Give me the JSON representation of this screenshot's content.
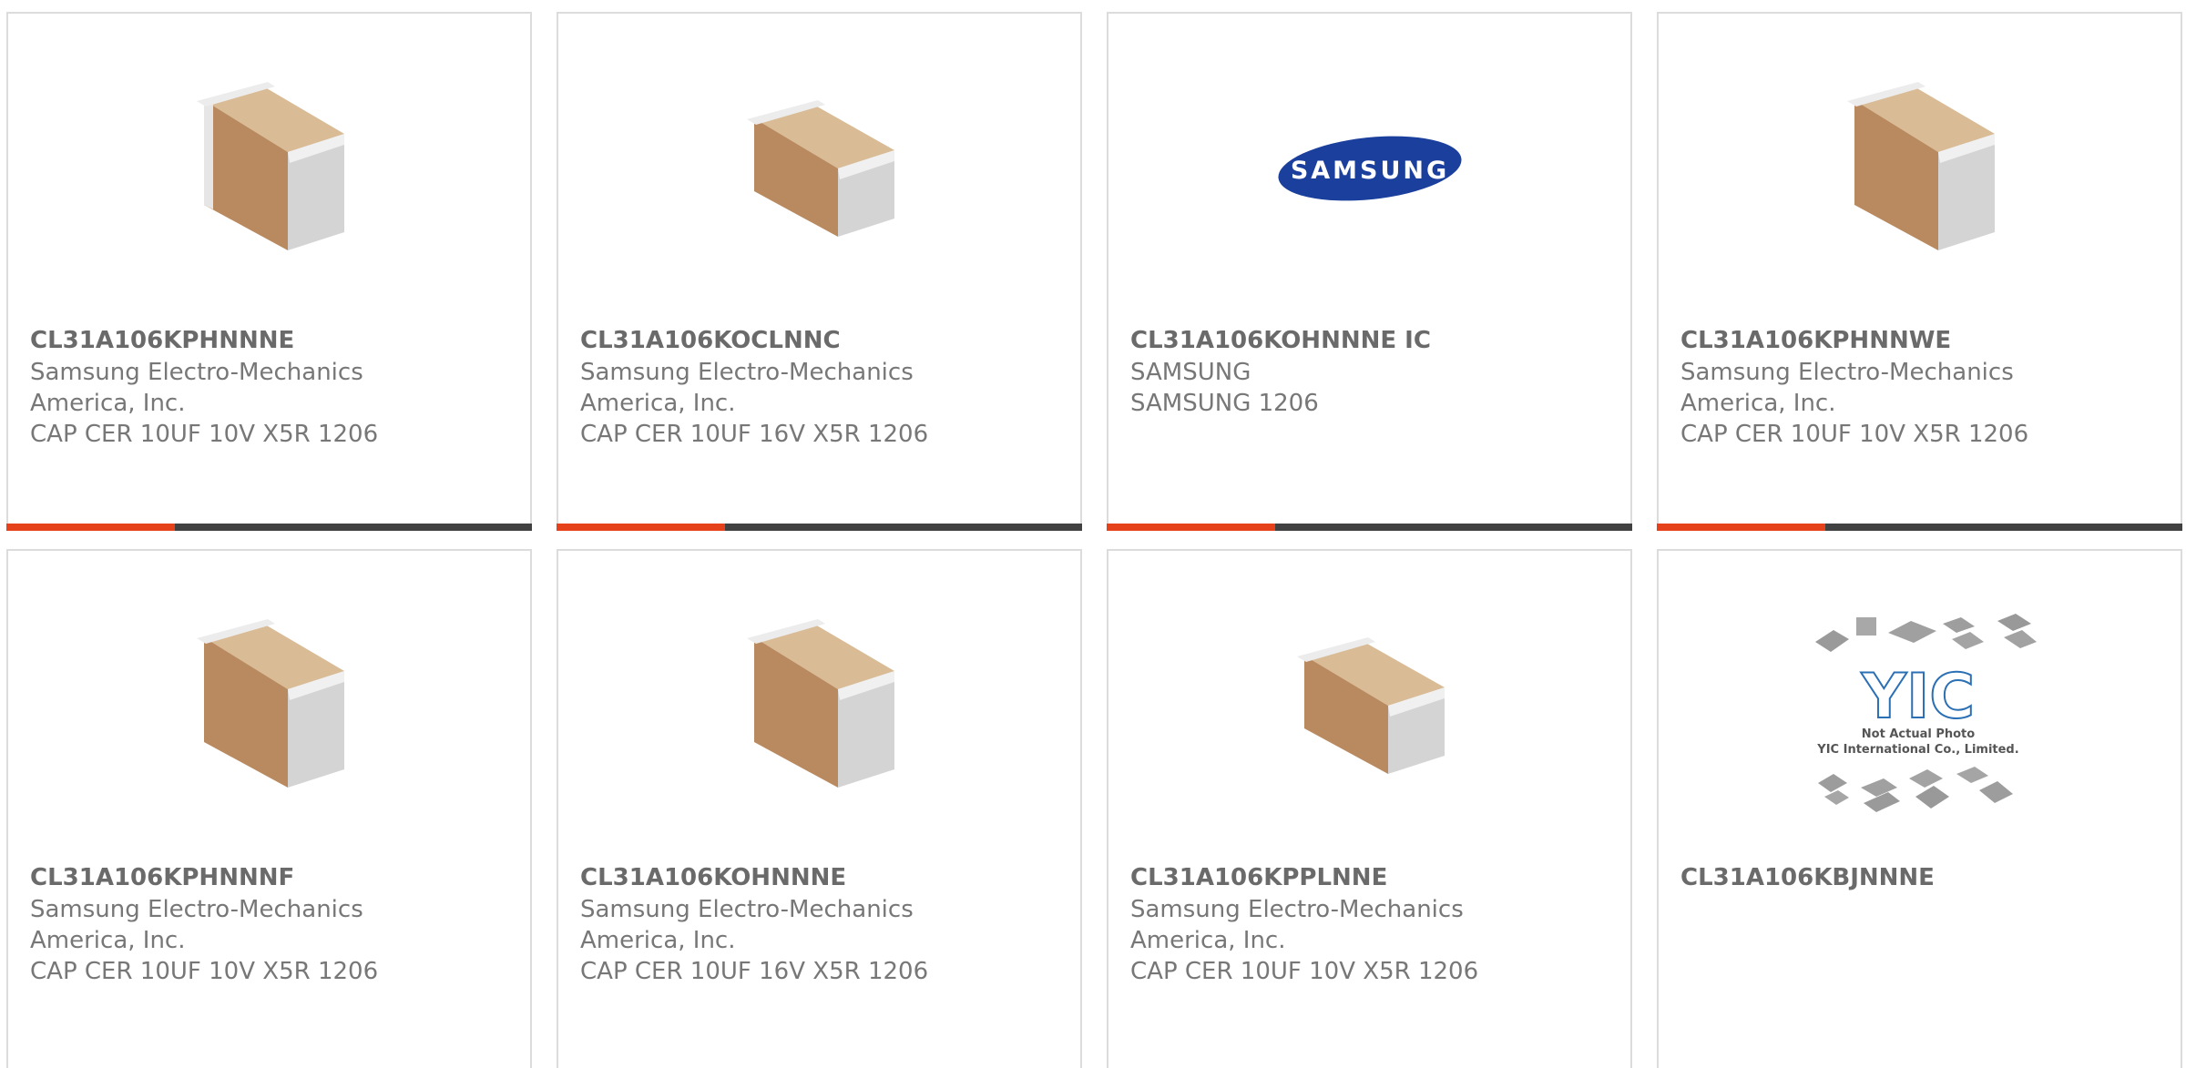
{
  "accent_color": "#e5411a",
  "bar_color": "#414141",
  "products": [
    {
      "part": "CL31A106KPHNNNE",
      "lines": [
        "Samsung Electro-Mechanics",
        "America, Inc.",
        "CAP CER 10UF 10V X5R 1206"
      ],
      "image": "capacitor-chip",
      "progress": 0.32
    },
    {
      "part": "CL31A106KOCLNNC",
      "lines": [
        "Samsung Electro-Mechanics",
        "America, Inc.",
        "CAP CER 10UF 16V X5R 1206"
      ],
      "image": "capacitor-chip-flat",
      "progress": 0.32
    },
    {
      "part": "CL31A106KOHNNNE IC",
      "lines": [
        "SAMSUNG",
        "SAMSUNG 1206"
      ],
      "image": "samsung-logo",
      "logo_text": "SAMSUNG",
      "progress": 0.32
    },
    {
      "part": "CL31A106KPHNNWE",
      "lines": [
        "Samsung Electro-Mechanics",
        "America, Inc.",
        "CAP CER 10UF 10V X5R 1206"
      ],
      "image": "capacitor-chip",
      "progress": 0.32
    },
    {
      "part": "CL31A106KPHNNNF",
      "lines": [
        "Samsung Electro-Mechanics",
        "America, Inc.",
        "CAP CER 10UF 10V X5R 1206"
      ],
      "image": "capacitor-chip"
    },
    {
      "part": "CL31A106KOHNNNE",
      "lines": [
        "Samsung Electro-Mechanics",
        "America, Inc.",
        "CAP CER 10UF 16V X5R 1206"
      ],
      "image": "capacitor-chip"
    },
    {
      "part": "CL31A106KPPLNNE",
      "lines": [
        "Samsung Electro-Mechanics",
        "America, Inc.",
        "CAP CER 10UF 10V X5R 1206"
      ],
      "image": "capacitor-chip-flat"
    },
    {
      "part": "CL31A106KBJNNNE",
      "lines": [],
      "image": "yic-placeholder",
      "placeholder_lines": [
        "Not Actual Photo",
        "YIC International Co., Limited."
      ],
      "logo_text": "YIC"
    }
  ]
}
